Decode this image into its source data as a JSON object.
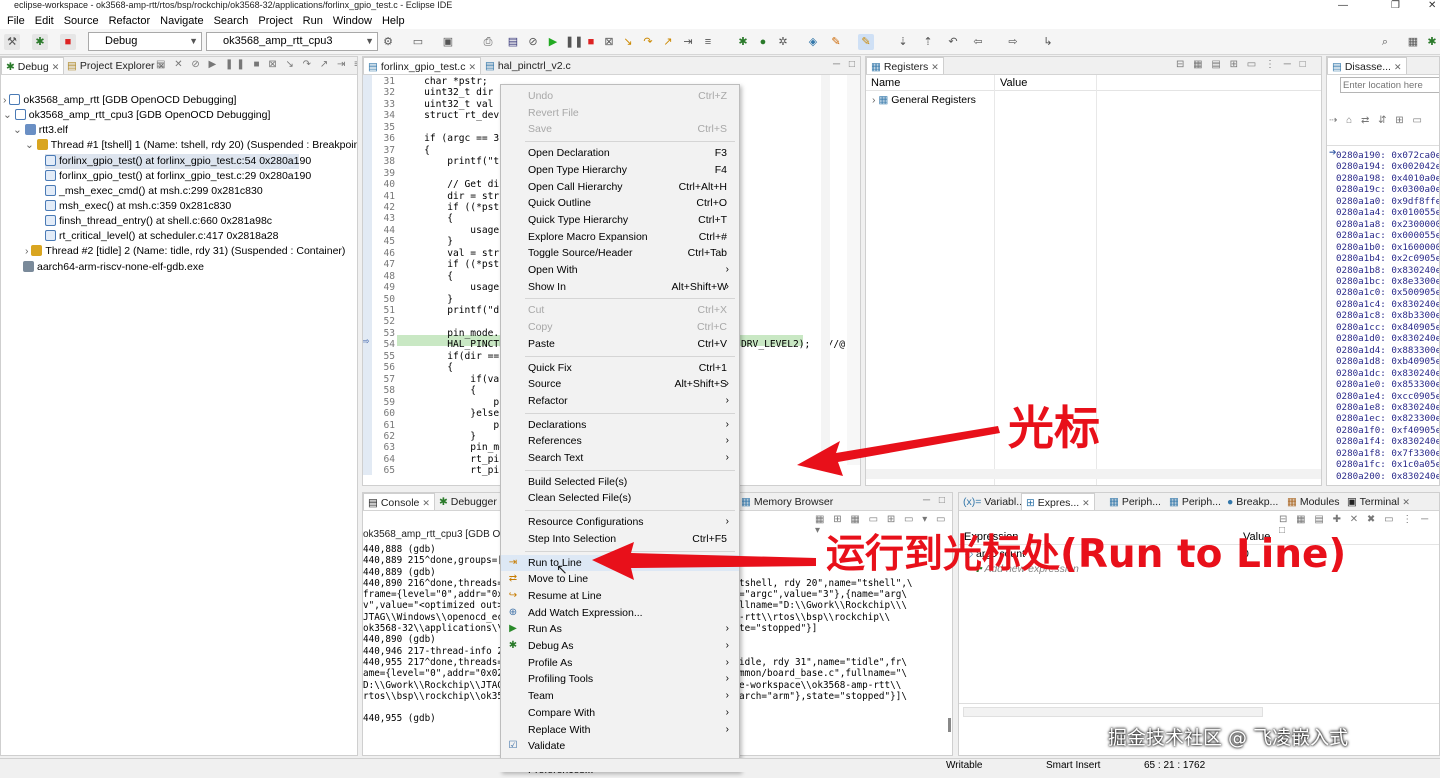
{
  "window": {
    "title": "eclipse-workspace - ok3568-amp-rtt/rtos/bsp/rockchip/ok3568-32/applications/forlinx_gpio_test.c - Eclipse IDE"
  },
  "menubar": [
    "File",
    "Edit",
    "Source",
    "Refactor",
    "Navigate",
    "Search",
    "Project",
    "Run",
    "Window",
    "Help"
  ],
  "toolbar": {
    "launch_mode": "Debug",
    "launch_config": "ok3568_amp_rtt_cpu3"
  },
  "debug_view": {
    "tabs": [
      "Debug",
      "Project Explorer"
    ],
    "rows": [
      "ok3568_amp_rtt [GDB OpenOCD Debugging]",
      "ok3568_amp_rtt_cpu3 [GDB OpenOCD Debugging]",
      "rtt3.elf",
      "Thread #1 [tshell] 1 (Name: tshell, rdy 20) (Suspended : Breakpoint)",
      "forlinx_gpio_test() at forlinx_gpio_test.c:54 0x280a190",
      "forlinx_gpio_test() at forlinx_gpio_test.c:29 0x280a190",
      "_msh_exec_cmd() at msh.c:299 0x281c830",
      "msh_exec() at msh.c:359 0x281c830",
      "finsh_thread_entry() at shell.c:660 0x281a98c",
      "rt_critical_level() at scheduler.c:417 0x2818a28",
      "Thread #2 [tidle] 2 (Name: tidle, rdy 31) (Suspended : Container)",
      "aarch64-arm-riscv-none-elf-gdb.exe"
    ]
  },
  "editor": {
    "tabs": [
      "forlinx_gpio_test.c",
      "hal_pinctrl_v2.c"
    ],
    "line_numbers": [
      "31",
      "32",
      "33",
      "34",
      "35",
      "36",
      "37",
      "38",
      "39",
      "40",
      "41",
      "42",
      "43",
      "44",
      "45",
      "46",
      "47",
      "48",
      "49",
      "50",
      "51",
      "52",
      "53",
      "54",
      "55",
      "56",
      "57",
      "58",
      "59",
      "60",
      "61",
      "62",
      "63",
      "64",
      "65"
    ],
    "lines": [
      "    char *pstr;",
      "    uint32_t dir   =",
      "    uint32_t val   =",
      "    struct rt_device",
      "",
      "    if (argc == 3)",
      "    {",
      "        printf(\"this",
      "",
      "        // Get dir:",
      "        dir = strtol",
      "        if ((*pstr !",
      "        {",
      "            usage();",
      "        }",
      "        val = strtol",
      "        if ((*pstr !",
      "        {",
      "            usage();",
      "        }",
      "        printf(\"dir",
      "",
      "        pin_mode.pin",
      "        HAL_PINCTRL_",
      "        if(dir == 1)",
      "        {",
      "            if(val =",
      "            {",
      "                prin",
      "            }else{",
      "                prin",
      "            }",
      "            pin_mode",
      "            rt_pin_m",
      "            rt_pin_w"
    ],
    "line54_tail": "DRV_LEVEL2);   //@"
  },
  "context_menu": {
    "items": [
      {
        "label": "Undo",
        "shortcut": "Ctrl+Z",
        "disabled": true
      },
      {
        "label": "Revert File",
        "disabled": true
      },
      {
        "label": "Save",
        "shortcut": "Ctrl+S",
        "disabled": true
      },
      {
        "sep": true
      },
      {
        "label": "Open Declaration",
        "shortcut": "F3"
      },
      {
        "label": "Open Type Hierarchy",
        "shortcut": "F4"
      },
      {
        "label": "Open Call Hierarchy",
        "shortcut": "Ctrl+Alt+H"
      },
      {
        "label": "Quick Outline",
        "shortcut": "Ctrl+O"
      },
      {
        "label": "Quick Type Hierarchy",
        "shortcut": "Ctrl+T"
      },
      {
        "label": "Explore Macro Expansion",
        "shortcut": "Ctrl+#"
      },
      {
        "label": "Toggle Source/Header",
        "shortcut": "Ctrl+Tab"
      },
      {
        "label": "Open With",
        "sub": true
      },
      {
        "label": "Show In",
        "shortcut": "Alt+Shift+W",
        "sub": true
      },
      {
        "sep": true
      },
      {
        "label": "Cut",
        "shortcut": "Ctrl+X",
        "disabled": true
      },
      {
        "label": "Copy",
        "shortcut": "Ctrl+C",
        "disabled": true
      },
      {
        "label": "Paste",
        "shortcut": "Ctrl+V"
      },
      {
        "sep": true
      },
      {
        "label": "Quick Fix",
        "shortcut": "Ctrl+1"
      },
      {
        "label": "Source",
        "shortcut": "Alt+Shift+S",
        "sub": true
      },
      {
        "label": "Refactor",
        "sub": true
      },
      {
        "sep": true
      },
      {
        "label": "Declarations",
        "sub": true
      },
      {
        "label": "References",
        "sub": true
      },
      {
        "label": "Search Text",
        "sub": true
      },
      {
        "sep": true
      },
      {
        "label": "Build Selected File(s)"
      },
      {
        "label": "Clean Selected File(s)"
      },
      {
        "sep": true
      },
      {
        "label": "Resource Configurations",
        "sub": true
      },
      {
        "label": "Step Into Selection",
        "shortcut": "Ctrl+F5"
      },
      {
        "sep": true
      },
      {
        "label": "Run to Line",
        "shortcut": "Ctrl+R",
        "highlight": true,
        "icon": "run-to-line-icon"
      },
      {
        "label": "Move to Line",
        "icon": "move-to-line-icon"
      },
      {
        "label": "Resume at Line",
        "icon": "resume-at-line-icon"
      },
      {
        "label": "Add Watch Expression...",
        "icon": "watch-icon"
      },
      {
        "label": "Run As",
        "sub": true,
        "icon": "run-icon"
      },
      {
        "label": "Debug As",
        "sub": true,
        "icon": "debug-icon"
      },
      {
        "label": "Profile As",
        "sub": true
      },
      {
        "label": "Profiling Tools",
        "sub": true
      },
      {
        "label": "Team",
        "sub": true
      },
      {
        "label": "Compare With",
        "sub": true
      },
      {
        "label": "Replace With",
        "sub": true
      },
      {
        "label": "Validate",
        "icon": "check-icon"
      },
      {
        "sep": true
      },
      {
        "label": "Preferences..."
      }
    ]
  },
  "registers": {
    "tab": "Registers",
    "col_name": "Name",
    "col_value": "Value",
    "row": "General Registers"
  },
  "disassembly": {
    "tab": "Disasse...",
    "location_placeholder": "Enter location here",
    "rows": [
      "0280a190: 0x072ca0e3",
      "0280a194: 0x002042e3",
      "0280a198: 0x4010a0e3",
      "0280a19c: 0x0300a0e3",
      "0280a1a0: 0x9df8ffeb",
      "0280a1a4: 0x010055e3",
      "0280a1a8: 0x2300000a",
      "0280a1ac: 0x000055e3",
      "0280a1b0: 0x1600000a",
      "0280a1b4: 0x2c0905e3",
      "0280a1b8: 0x830240e3",
      "0280a1bc: 0x8e3300eb",
      "0280a1c0: 0x500905e3",
      "0280a1c4: 0x830240e3",
      "0280a1c8: 0x8b3300eb",
      "0280a1cc: 0x840905e3",
      "0280a1d0: 0x830240e3",
      "0280a1d4: 0x883300eb",
      "0280a1d8: 0xb40905e3",
      "0280a1dc: 0x830240e3",
      "0280a1e0: 0x853300eb",
      "0280a1e4: 0xcc0905e3",
      "0280a1e8: 0x830240e3",
      "0280a1ec: 0x823300eb",
      "0280a1f0: 0xf40905e3",
      "0280a1f4: 0x830240e3",
      "0280a1f8: 0x7f3300eb",
      "0280a1fc: 0x1c0a05e3",
      "0280a200: 0x830240e3"
    ]
  },
  "console": {
    "tabs": [
      "Console",
      "Debugger"
    ],
    "header": "ok3568_amp_rtt_cpu3 [GDB Ope",
    "left": [
      "440,888 (gdb)",
      "440,889 215^done,groups=[{",
      "440,889 (gdb)",
      "440,890 216^done,threads=[",
      "frame={level=\"0\",addr=\"0x0",
      "v\",value=\"<optimized out>\"",
      "JTAG\\\\Windows\\\\openocd_ecl",
      "ok3568-32\\\\applications\\\\f",
      "440,890 (gdb)",
      "440,946 217-thread-info 2",
      "440,955 217^done,threads=[",
      "ame={level=\"0\",addr=\"0x028",
      "D:\\\\Gwork\\\\Rockchip\\\\JTAG\\",
      "rtos\\\\bsp\\\\rockchip\\\\ok356",
      "",
      "440,955 (gdb)"
    ],
    "right": [
      "",
      "",
      "",
      "tshell, rdy 20\",name=\"tshell\",\\",
      "=\"argc\",value=\"3\"},{name=\"arg\\",
      "llname=\"D:\\\\Gwork\\\\Rockchip\\\\\\",
      "-rtt\\\\rtos\\\\bsp\\\\rockchip\\\\",
      "te=\"stopped\"}]",
      "",
      "",
      "idle, rdy 31\",name=\"tidle\",fr\\",
      "mmon/board_base.c\",fullname=\"\\",
      "e-workspace\\\\ok3568-amp-rtt\\\\",
      "arch=\"arm\"},state=\"stopped\"}]\\",
      "",
      ""
    ]
  },
  "memory": {
    "tab": "Memory Browser"
  },
  "expressions": {
    "tabs": [
      "Variabl...",
      "Expres...",
      "Periph...",
      "Periph...",
      "Breakp...",
      "Modules",
      "Terminal"
    ],
    "col_expression": "Expression",
    "col_value": "Value",
    "row_expr": "argc count",
    "row_value": "0",
    "add_label": "Add new expression"
  },
  "status": {
    "mode": "Writable",
    "insert": "Smart Insert",
    "position": "65 : 21 : 1762"
  },
  "annotations": {
    "cursor_label": "光标",
    "run_to_line_label": "运行到光标处(Run to Line)",
    "color": "#e8101a"
  },
  "watermark": "掘金技术社区 @ 飞凌嵌入式"
}
